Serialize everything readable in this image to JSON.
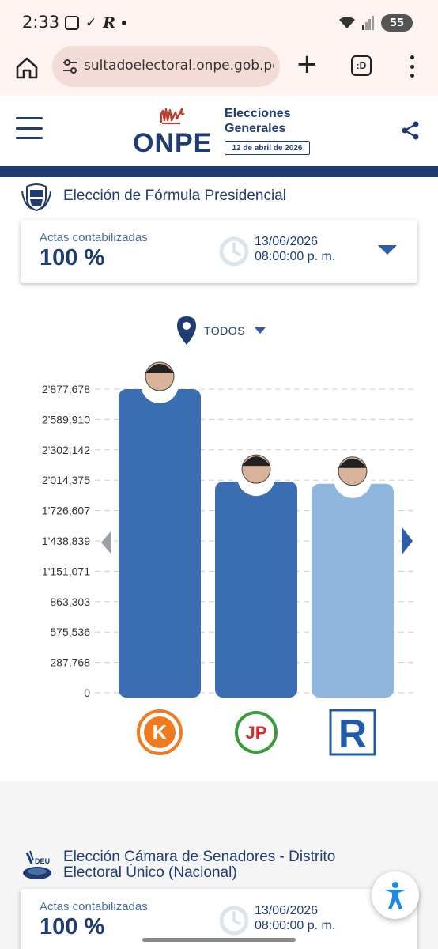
{
  "status_bar": {
    "time": "2:33",
    "battery": "55"
  },
  "browser": {
    "url": "sultadoelectoral.onpe.gob.pe",
    "tabs_label": ":D"
  },
  "header": {
    "brand": "ONPE",
    "subtitle": "Elecciones Generales",
    "date_badge": "12 de abril de 2026"
  },
  "section1": {
    "title": "Elección de Fórmula Presidencial",
    "actas_label": "Actas contabilizadas",
    "actas_value": "100 %",
    "date": "13/06/2026",
    "time": "08:00:00 p. m.",
    "filter_label": "TODOS"
  },
  "chart_data": {
    "type": "bar",
    "ylim": [
      0,
      2877678
    ],
    "y_ticks": [
      "2'877,678",
      "2'589,910",
      "2'302,142",
      "2'014,375",
      "1'726,607",
      "1'438,839",
      "1'151,071",
      "863,303",
      "575,536",
      "287,768",
      "0"
    ],
    "y_tick_values": [
      2877678,
      2589910,
      2302142,
      2014375,
      1726607,
      1438839,
      1151071,
      863303,
      575536,
      287768,
      0
    ],
    "values": [
      2877678,
      2000000,
      1980000
    ],
    "colors": [
      "#3b6db3",
      "#3b6db3",
      "#8fb6de"
    ],
    "logos": [
      "K",
      "JP",
      "R"
    ]
  },
  "section2": {
    "title": "Elección Cámara de Senadores - Distrito Electoral Único (Nacional)",
    "actas_label": "Actas contabilizadas",
    "actas_value": "100 %",
    "date": "13/06/2026",
    "time": "08:00:00 p. m.",
    "icon_label": "DEU"
  }
}
